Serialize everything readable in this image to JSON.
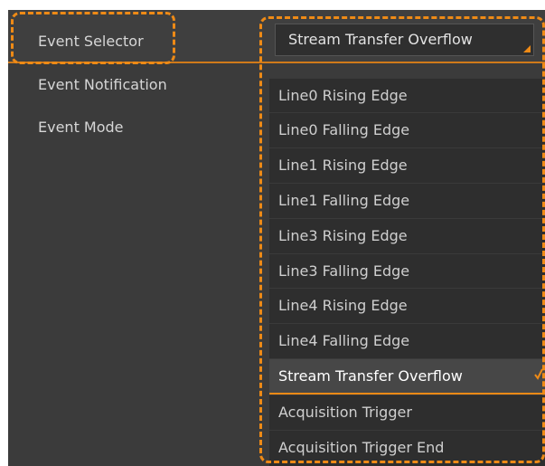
{
  "properties": [
    {
      "label": "Event Selector"
    },
    {
      "label": "Event Notification"
    },
    {
      "label": "Event Mode"
    }
  ],
  "event_selector": {
    "value": "Stream Transfer Overflow",
    "options": [
      {
        "label": "Line0 Rising Edge"
      },
      {
        "label": "Line0 Falling Edge"
      },
      {
        "label": "Line1 Rising Edge"
      },
      {
        "label": "Line1 Falling Edge"
      },
      {
        "label": "Line3 Rising Edge"
      },
      {
        "label": "Line3 Falling Edge"
      },
      {
        "label": "Line4 Rising Edge"
      },
      {
        "label": "Line4 Falling Edge"
      },
      {
        "label": "Stream Transfer Overflow"
      },
      {
        "label": "Acquisition Trigger"
      },
      {
        "label": "Acquisition Trigger End"
      }
    ],
    "selected_option": "Stream Transfer Overflow"
  },
  "colors": {
    "accent": "#ee8a16",
    "panel_bg": "#3b3b3b",
    "dropdown_bg": "#2e2e2e",
    "text": "#d6d6d6"
  },
  "icons": {
    "caret": "dropdown-caret-icon",
    "check": "check-icon"
  }
}
